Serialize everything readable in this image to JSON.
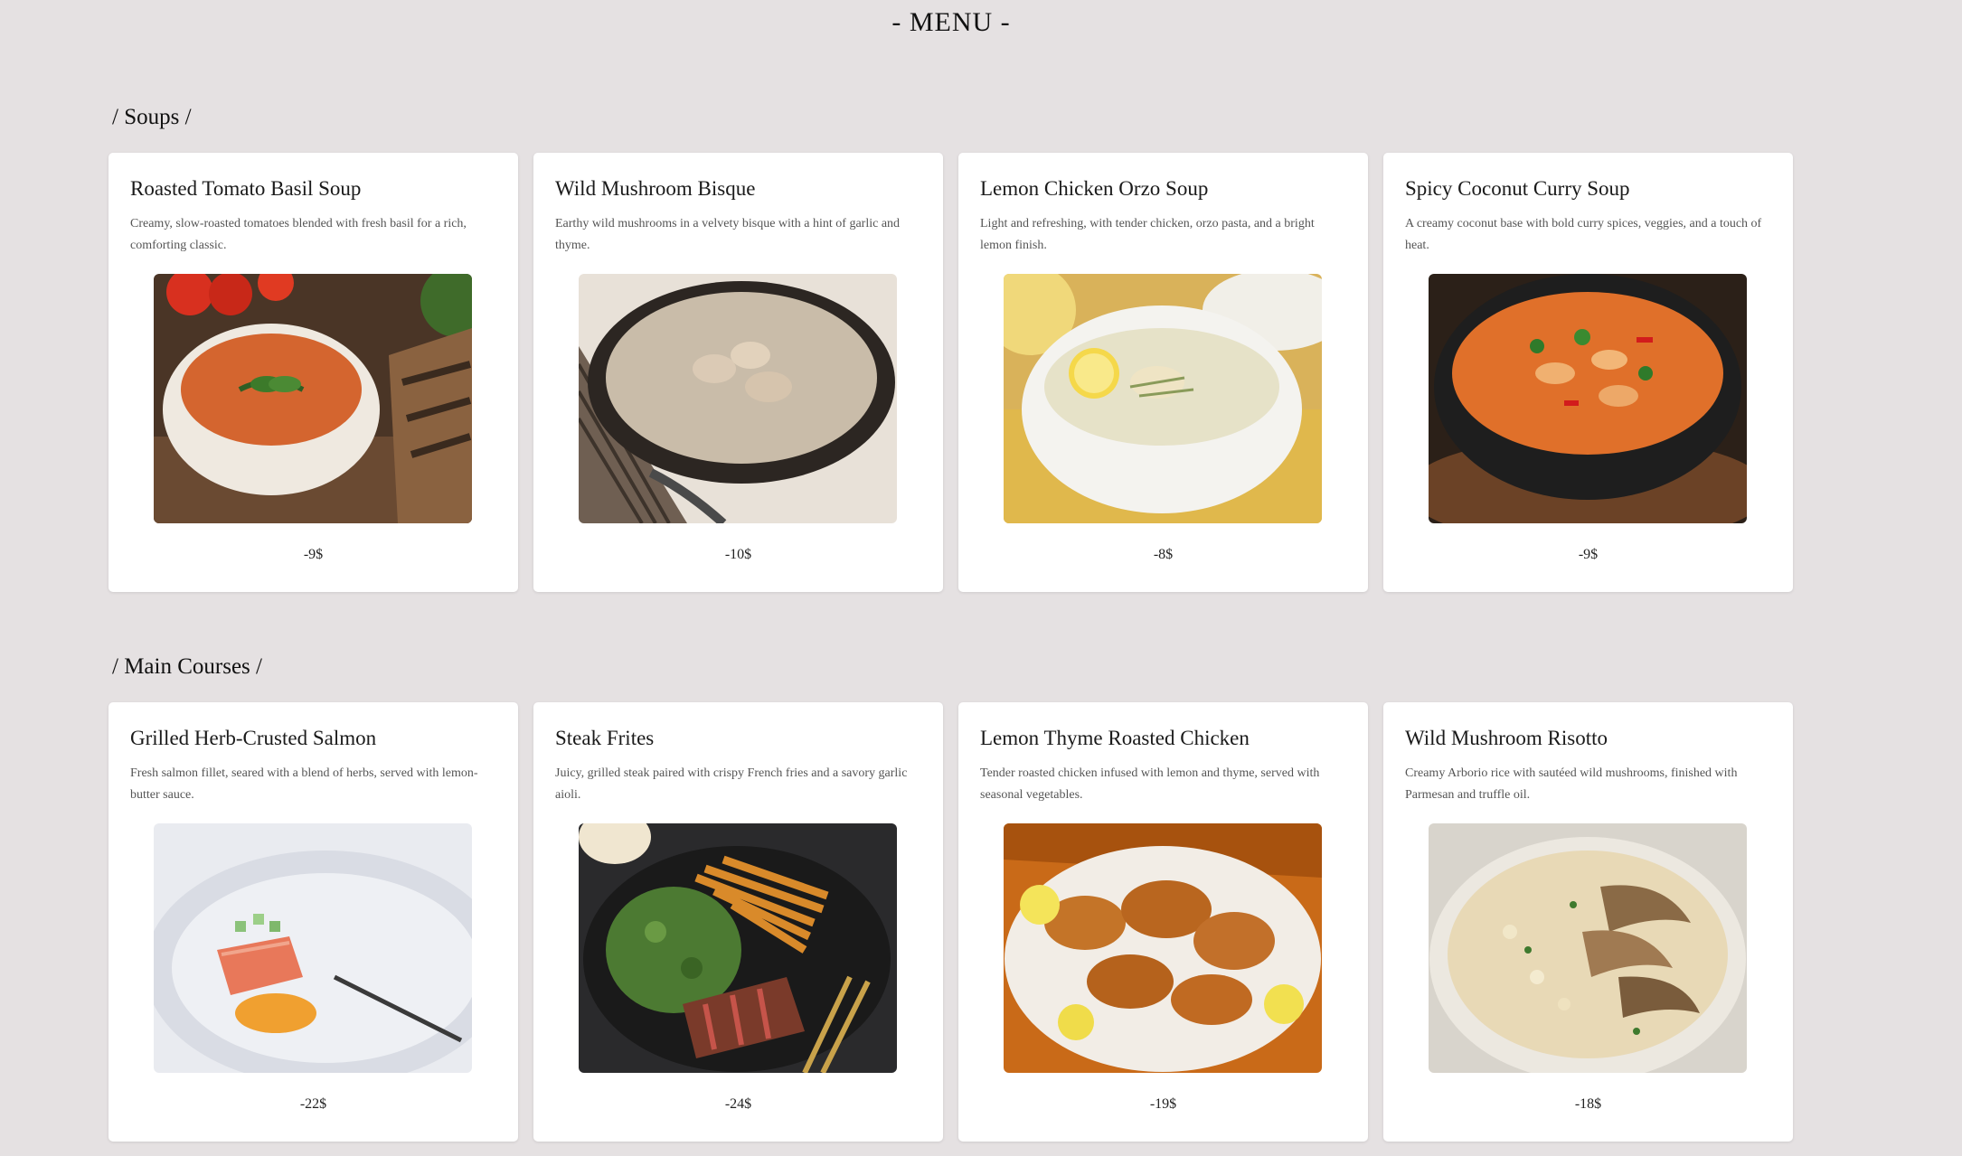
{
  "header": {
    "title": "- MENU -"
  },
  "sections": [
    {
      "heading": "/ Soups /",
      "items": [
        {
          "name": "Roasted Tomato Basil Soup",
          "description": "Creamy, slow-roasted tomatoes blended with fresh basil for a rich, comforting classic.",
          "price": "-9$",
          "image_icon": "tomato-soup-image"
        },
        {
          "name": "Wild Mushroom Bisque",
          "description": "Earthy wild mushrooms in a velvety bisque with a hint of garlic and thyme.",
          "price": "-10$",
          "image_icon": "mushroom-bisque-image"
        },
        {
          "name": "Lemon Chicken Orzo Soup",
          "description": "Light and refreshing, with tender chicken, orzo pasta, and a bright lemon finish.",
          "price": "-8$",
          "image_icon": "chicken-orzo-soup-image"
        },
        {
          "name": "Spicy Coconut Curry Soup",
          "description": "A creamy coconut base with bold curry spices, veggies, and a touch of heat.",
          "price": "-9$",
          "image_icon": "coconut-curry-soup-image"
        }
      ]
    },
    {
      "heading": "/ Main Courses /",
      "items": [
        {
          "name": "Grilled Herb-Crusted Salmon",
          "description": "Fresh salmon fillet, seared with a blend of herbs, served with lemon-butter sauce.",
          "price": "-22$",
          "image_icon": "salmon-image"
        },
        {
          "name": "Steak Frites",
          "description": "Juicy, grilled steak paired with crispy French fries and a savory garlic aioli.",
          "price": "-24$",
          "image_icon": "steak-frites-image"
        },
        {
          "name": "Lemon Thyme Roasted Chicken",
          "description": "Tender roasted chicken infused with lemon and thyme, served with seasonal vegetables.",
          "price": "-19$",
          "image_icon": "roasted-chicken-image"
        },
        {
          "name": "Wild Mushroom Risotto",
          "description": "Creamy Arborio rice with sautéed wild mushrooms, finished with Parmesan and truffle oil.",
          "price": "-18$",
          "image_icon": "mushroom-risotto-image"
        }
      ]
    }
  ],
  "colors": {
    "page_background": "#e5e1e2",
    "card_background": "#ffffff",
    "text": "#111111"
  }
}
